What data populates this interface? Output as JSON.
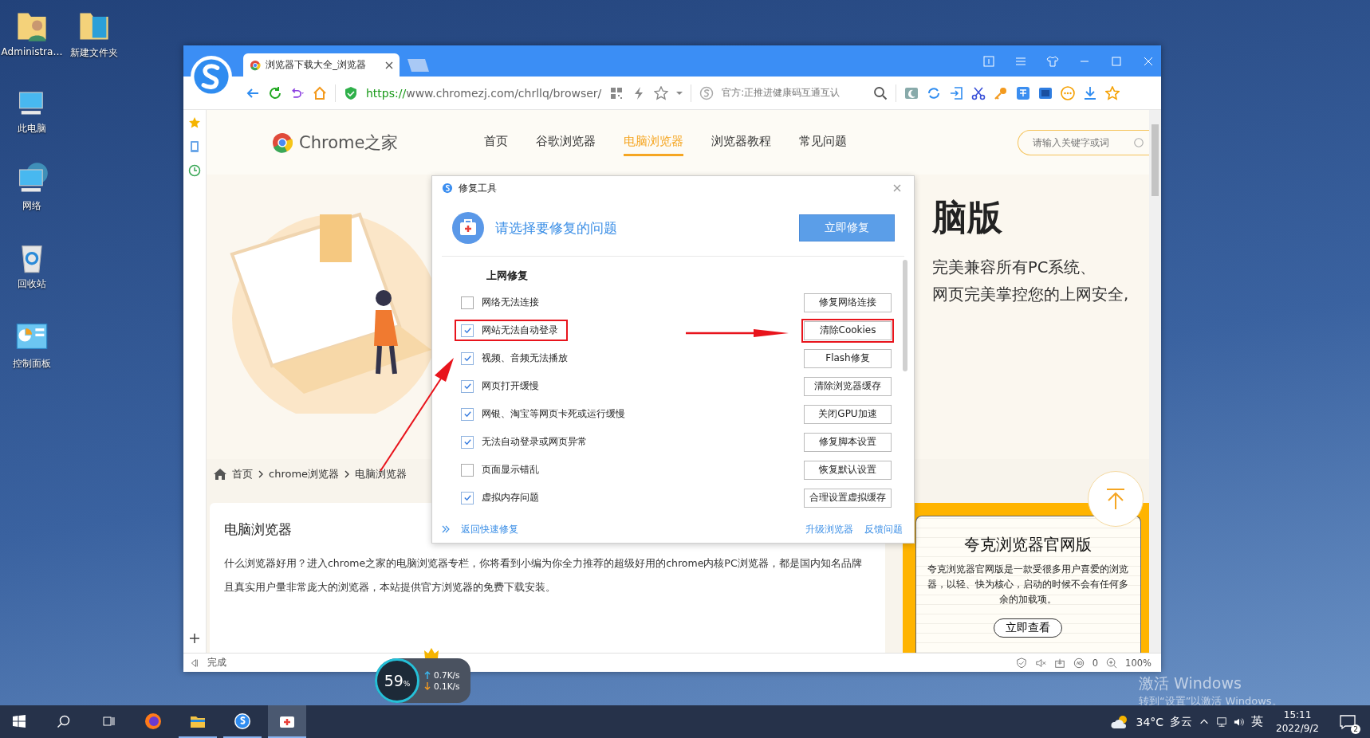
{
  "desktop_icons": [
    {
      "label": "Administra…",
      "kind": "user-folder"
    },
    {
      "label": "新建文件夹",
      "kind": "folder"
    },
    {
      "label": "此电脑",
      "kind": "computer"
    },
    {
      "label": "网络",
      "kind": "network"
    },
    {
      "label": "回收站",
      "kind": "recycle"
    },
    {
      "label": "控制面板",
      "kind": "control"
    }
  ],
  "browser": {
    "tab_title": "浏览器下载大全_浏览器",
    "url_scheme": "https://",
    "url_rest": "www.chromezj.com/chrllq/browser/",
    "search_hint": "官方:正推进健康码互通互认",
    "status": "完成",
    "ad_count": "0",
    "zoom": "100%"
  },
  "site": {
    "logo": "Chrome之家",
    "nav": [
      {
        "label": "首页",
        "selected": false
      },
      {
        "label": "谷歌浏览器",
        "selected": false
      },
      {
        "label": "电脑浏览器",
        "selected": true
      },
      {
        "label": "浏览器教程",
        "selected": false
      },
      {
        "label": "常见问题",
        "selected": false
      }
    ],
    "search_placeholder": "请输入关键字或词",
    "hero_title": "脑版",
    "hero_lines": [
      "完美兼容所有PC系统、",
      "网页完美掌控您的上网安全,"
    ],
    "breadcrumb": [
      "首页",
      "chrome浏览器",
      "电脑浏览器"
    ],
    "section_title": "电脑浏览器",
    "description": "什么浏览器好用？进入chrome之家的电脑浏览器专栏，你将看到小编为你全力推荐的超级好用的chrome内核PC浏览器，都是国内知名品牌且真实用户量非常庞大的浏览器，本站提供官方浏览器的免费下载安装。",
    "ad": {
      "title": "夸克浏览器官网版",
      "text": "夸克浏览器官网版是一款受很多用户喜爱的浏览器，以轻、快为核心，启动的时候不会有任何多余的加载项。",
      "button": "立即查看"
    }
  },
  "dialog": {
    "title": "修复工具",
    "heading": "请选择要修复的问题",
    "primary_button": "立即修复",
    "section": "上网修复",
    "items": [
      {
        "label": "网络无法连接",
        "checked": false,
        "action": "修复网络连接",
        "highlighted": false
      },
      {
        "label": "网站无法自动登录",
        "checked": true,
        "action": "清除Cookies",
        "highlighted": true
      },
      {
        "label": "视频、音频无法播放",
        "checked": true,
        "action": "Flash修复",
        "highlighted": false
      },
      {
        "label": "网页打开缓慢",
        "checked": true,
        "action": "清除浏览器缓存",
        "highlighted": false
      },
      {
        "label": "网银、淘宝等网页卡死或运行缓慢",
        "checked": true,
        "action": "关闭GPU加速",
        "highlighted": false
      },
      {
        "label": "无法自动登录或网页异常",
        "checked": true,
        "action": "修复脚本设置",
        "highlighted": false
      },
      {
        "label": "页面显示错乱",
        "checked": false,
        "action": "恢复默认设置",
        "highlighted": false
      },
      {
        "label": "虚拟内存问题",
        "checked": true,
        "action": "合理设置虚拟缓存",
        "highlighted": false
      }
    ],
    "back_link": "返回快速修复",
    "links": [
      "升级浏览器",
      "反馈问题"
    ]
  },
  "network_widget": {
    "percent": "59",
    "unit": "%",
    "up": "0.7K/s",
    "down": "0.1K/s"
  },
  "activation": {
    "title": "激活 Windows",
    "hint": "转到“设置”以激活 Windows。"
  },
  "taskbar": {
    "weather": "34°C",
    "condition": "多云",
    "ime": "英",
    "time": "15:11",
    "date": "2022/9/2",
    "notifications": "2"
  }
}
